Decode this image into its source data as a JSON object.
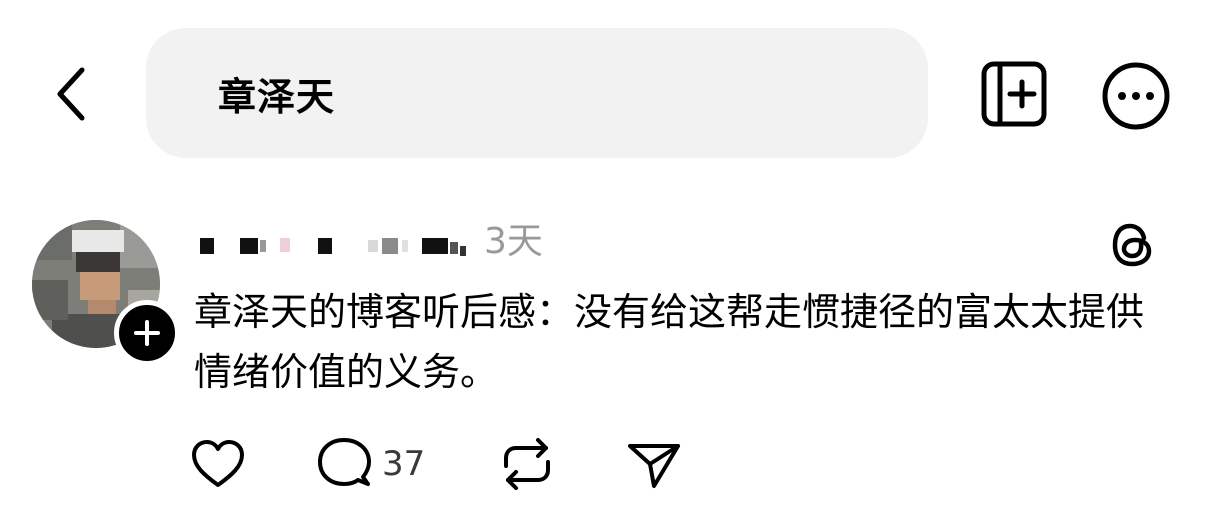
{
  "header": {
    "search_query": "章泽天"
  },
  "post": {
    "time_ago": "3天",
    "text": "章泽天的博客听后感：没有给这帮走惯捷径的富太太提供情绪价值的义务。",
    "comment_count": "37"
  },
  "icons": {
    "back": "chevron-left-icon",
    "new_post": "new-post-icon",
    "more": "more-icon",
    "follow": "plus-icon",
    "threads": "threads-logo-icon",
    "like": "heart-icon",
    "comment": "comment-icon",
    "repost": "repost-icon",
    "share": "send-icon"
  },
  "colors": {
    "search_bg": "#f2f2f2",
    "muted_text": "#999999",
    "icon": "#000000"
  }
}
